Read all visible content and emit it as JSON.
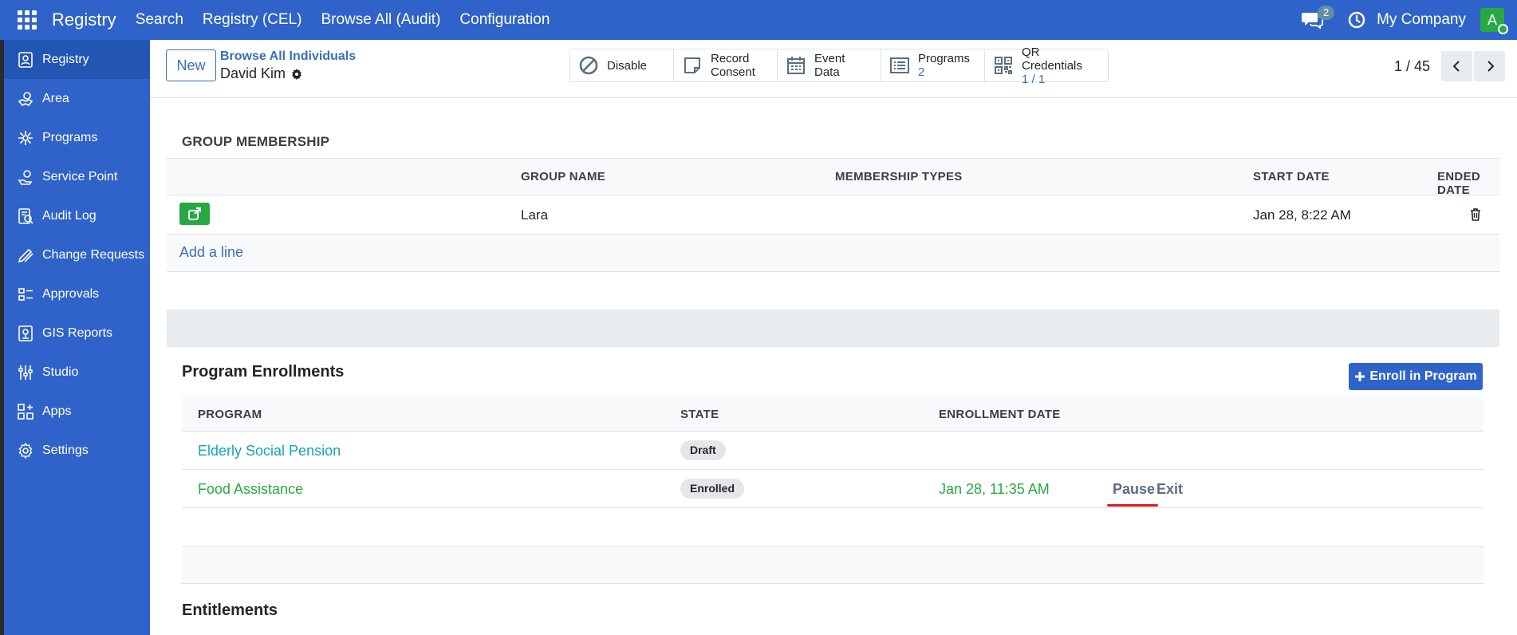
{
  "topbar": {
    "brand": "Registry",
    "menu": [
      "Search",
      "Registry (CEL)",
      "Browse All (Audit)",
      "Configuration"
    ],
    "chat_count": "2",
    "company": "My Company",
    "avatar_letter": "A"
  },
  "sidebar": {
    "items": [
      {
        "label": "Registry",
        "icon": "registry-icon",
        "active": true
      },
      {
        "label": "Area",
        "icon": "area-icon"
      },
      {
        "label": "Programs",
        "icon": "programs-icon"
      },
      {
        "label": "Service Point",
        "icon": "service-point-icon"
      },
      {
        "label": "Audit Log",
        "icon": "audit-log-icon"
      },
      {
        "label": "Change Requests",
        "icon": "change-requests-icon"
      },
      {
        "label": "Approvals",
        "icon": "approvals-icon"
      },
      {
        "label": "GIS Reports",
        "icon": "gis-reports-icon"
      },
      {
        "label": "Studio",
        "icon": "studio-icon"
      },
      {
        "label": "Apps",
        "icon": "apps-icon"
      },
      {
        "label": "Settings",
        "icon": "settings-icon"
      }
    ]
  },
  "control": {
    "new_label": "New",
    "breadcrumb": "Browse All Individuals",
    "record_name": "David Kim",
    "stat_buttons": {
      "disable": "Disable",
      "record_consent_1": "Record",
      "record_consent_2": "Consent",
      "event_data_1": "Event",
      "event_data_2": "Data",
      "programs_label": "Programs",
      "programs_count": "2",
      "qr_label": "QR Credentials",
      "qr_count": "1 / 1"
    },
    "pager": "1 / 45"
  },
  "group_membership": {
    "title": "GROUP MEMBERSHIP",
    "columns": [
      "GROUP NAME",
      "MEMBERSHIP TYPES",
      "START DATE",
      "ENDED DATE"
    ],
    "rows": [
      {
        "group_name": "Lara",
        "membership_types": "",
        "start_date": "Jan 28, 8:22 AM",
        "ended_date": ""
      }
    ],
    "add_line": "Add a line"
  },
  "program_enrollments": {
    "title": "Program Enrollments",
    "enroll_button": "Enroll in Program",
    "columns": [
      "PROGRAM",
      "STATE",
      "ENROLLMENT DATE"
    ],
    "rows": [
      {
        "program": "Elderly Social Pension",
        "state": "Draft",
        "enrollment_date": "",
        "color": "#17a2b8"
      },
      {
        "program": "Food Assistance",
        "state": "Enrolled",
        "enrollment_date": "Jan 28, 11:35 AM",
        "color": "#28a745",
        "actions": [
          "Pause",
          "Exit"
        ]
      }
    ]
  },
  "entitlements": {
    "title": "Entitlements"
  },
  "colors": {
    "primary": "#2f63c9",
    "link": "#3a6fb5",
    "success": "#28a745",
    "highlight": "#e01919"
  }
}
